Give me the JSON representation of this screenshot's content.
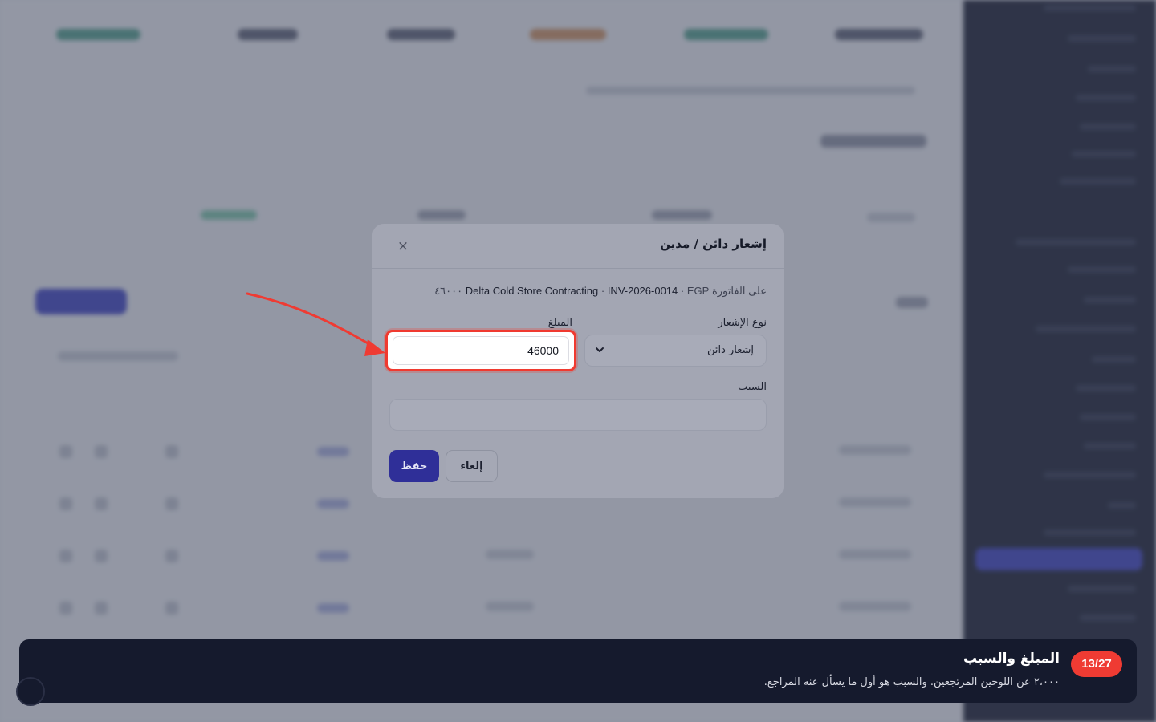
{
  "modal": {
    "title": "إشعار دائن / مدين",
    "close_label": "×",
    "invoice_prefix": "على الفاتورة",
    "invoice_client": "Delta Cold Store Contracting",
    "invoice_number": "INV-2026-0014",
    "invoice_amount": "EGP ٤٦٠٠٠",
    "separator": "·",
    "type_label": "نوع الإشعار",
    "type_value": "إشعار دائن",
    "amount_label": "المبلغ",
    "amount_value": "46000",
    "reason_label": "السبب",
    "reason_value": "",
    "save_label": "حفظ",
    "cancel_label": "إلغاء"
  },
  "tour": {
    "step": "13/27",
    "title": "المبلغ والسبب",
    "description": "٢،٠٠٠ عن اللوحين المرتجعين. والسبب هو أول ما يسأل عنه المراجع."
  },
  "colors": {
    "accent": "#3b3fc4",
    "highlight": "#ef3b33",
    "tour_background": "#151a2d"
  },
  "icons": {
    "close": "close-icon",
    "select_arrow": "chevron-down-icon",
    "pointer": "arrow-icon"
  }
}
